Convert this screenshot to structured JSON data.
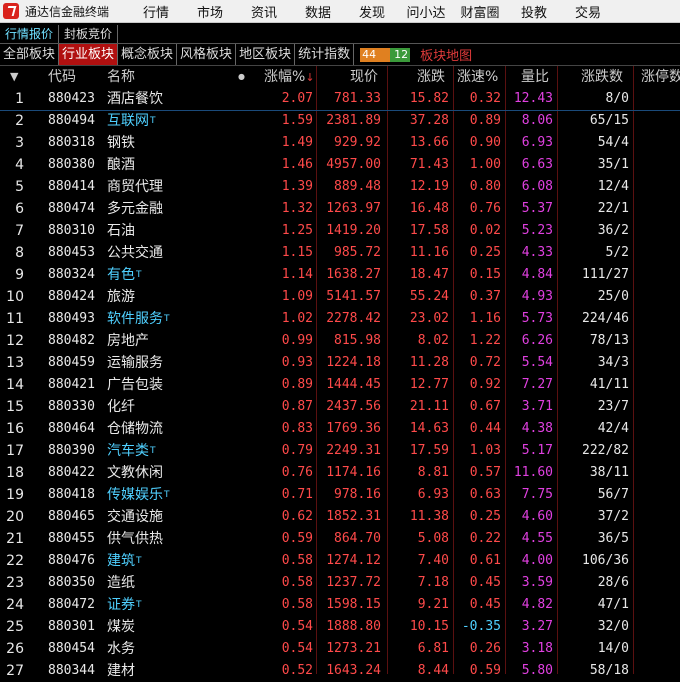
{
  "app": {
    "title": "通达信金融终端",
    "menu": [
      "行情",
      "市场",
      "资讯",
      "数据",
      "发现",
      "问小达",
      "财富圈",
      "投教",
      "交易"
    ]
  },
  "subtabs": [
    "行情报价",
    "封板竞价"
  ],
  "tabs": [
    "全部板块",
    "行业板块",
    "概念板块",
    "风格板块",
    "地区板块",
    "统计指数"
  ],
  "updown": {
    "up": "44",
    "down": "12"
  },
  "map_link": "板块地图",
  "columns": [
    "代码",
    "名称",
    "涨幅%",
    "现价",
    "涨跌",
    "涨速%",
    "量比",
    "涨跌数",
    "涨停数"
  ],
  "sort_arrow": "↓",
  "colors": {
    "up": "#ff4a4a",
    "down": "#4fd0ff",
    "volume_ratio": "#e040e0",
    "tag": "#4fd0ff"
  },
  "rows": [
    {
      "no": "1",
      "code": "880423",
      "name": "酒店餐饮",
      "tag": "",
      "pct": "2.07",
      "price": "781.33",
      "change": "15.82",
      "speed": "0.32",
      "vr": "12.43",
      "counts": "8/0"
    },
    {
      "no": "2",
      "code": "880494",
      "name": "互联网",
      "tag": "T",
      "pct": "1.59",
      "price": "2381.89",
      "change": "37.28",
      "speed": "0.89",
      "vr": "8.06",
      "counts": "65/15"
    },
    {
      "no": "3",
      "code": "880318",
      "name": "钢铁",
      "tag": "",
      "pct": "1.49",
      "price": "929.92",
      "change": "13.66",
      "speed": "0.90",
      "vr": "6.93",
      "counts": "54/4"
    },
    {
      "no": "4",
      "code": "880380",
      "name": "酿酒",
      "tag": "",
      "pct": "1.46",
      "price": "4957.00",
      "change": "71.43",
      "speed": "1.00",
      "vr": "6.63",
      "counts": "35/1"
    },
    {
      "no": "5",
      "code": "880414",
      "name": "商贸代理",
      "tag": "",
      "pct": "1.39",
      "price": "889.48",
      "change": "12.19",
      "speed": "0.80",
      "vr": "6.08",
      "counts": "12/4"
    },
    {
      "no": "6",
      "code": "880474",
      "name": "多元金融",
      "tag": "",
      "pct": "1.32",
      "price": "1263.97",
      "change": "16.48",
      "speed": "0.76",
      "vr": "5.37",
      "counts": "22/1"
    },
    {
      "no": "7",
      "code": "880310",
      "name": "石油",
      "tag": "",
      "pct": "1.25",
      "price": "1419.20",
      "change": "17.58",
      "speed": "0.02",
      "vr": "5.23",
      "counts": "36/2"
    },
    {
      "no": "8",
      "code": "880453",
      "name": "公共交通",
      "tag": "",
      "pct": "1.15",
      "price": "985.72",
      "change": "11.16",
      "speed": "0.25",
      "vr": "4.33",
      "counts": "5/2"
    },
    {
      "no": "9",
      "code": "880324",
      "name": "有色",
      "tag": "T",
      "pct": "1.14",
      "price": "1638.27",
      "change": "18.47",
      "speed": "0.15",
      "vr": "4.84",
      "counts": "111/27"
    },
    {
      "no": "10",
      "code": "880424",
      "name": "旅游",
      "tag": "",
      "pct": "1.09",
      "price": "5141.57",
      "change": "55.24",
      "speed": "0.37",
      "vr": "4.93",
      "counts": "25/0"
    },
    {
      "no": "11",
      "code": "880493",
      "name": "软件服务",
      "tag": "T",
      "pct": "1.02",
      "price": "2278.42",
      "change": "23.02",
      "speed": "1.16",
      "vr": "5.73",
      "counts": "224/46"
    },
    {
      "no": "12",
      "code": "880482",
      "name": "房地产",
      "tag": "",
      "pct": "0.99",
      "price": "815.98",
      "change": "8.02",
      "speed": "1.22",
      "vr": "6.26",
      "counts": "78/13"
    },
    {
      "no": "13",
      "code": "880459",
      "name": "运输服务",
      "tag": "",
      "pct": "0.93",
      "price": "1224.18",
      "change": "11.28",
      "speed": "0.72",
      "vr": "5.54",
      "counts": "34/3"
    },
    {
      "no": "14",
      "code": "880421",
      "name": "广告包装",
      "tag": "",
      "pct": "0.89",
      "price": "1444.45",
      "change": "12.77",
      "speed": "0.92",
      "vr": "7.27",
      "counts": "41/11"
    },
    {
      "no": "15",
      "code": "880330",
      "name": "化纤",
      "tag": "",
      "pct": "0.87",
      "price": "2437.56",
      "change": "21.11",
      "speed": "0.67",
      "vr": "3.71",
      "counts": "23/7"
    },
    {
      "no": "16",
      "code": "880464",
      "name": "仓储物流",
      "tag": "",
      "pct": "0.83",
      "price": "1769.36",
      "change": "14.63",
      "speed": "0.44",
      "vr": "4.38",
      "counts": "42/4"
    },
    {
      "no": "17",
      "code": "880390",
      "name": "汽车类",
      "tag": "T",
      "pct": "0.79",
      "price": "2249.31",
      "change": "17.59",
      "speed": "1.03",
      "vr": "5.17",
      "counts": "222/82"
    },
    {
      "no": "18",
      "code": "880422",
      "name": "文教休闲",
      "tag": "",
      "pct": "0.76",
      "price": "1174.16",
      "change": "8.81",
      "speed": "0.57",
      "vr": "11.60",
      "counts": "38/11"
    },
    {
      "no": "19",
      "code": "880418",
      "name": "传媒娱乐",
      "tag": "T",
      "pct": "0.71",
      "price": "978.16",
      "change": "6.93",
      "speed": "0.63",
      "vr": "7.75",
      "counts": "56/7"
    },
    {
      "no": "20",
      "code": "880465",
      "name": "交通设施",
      "tag": "",
      "pct": "0.62",
      "price": "1852.31",
      "change": "11.38",
      "speed": "0.25",
      "vr": "4.60",
      "counts": "37/2"
    },
    {
      "no": "21",
      "code": "880455",
      "name": "供气供热",
      "tag": "",
      "pct": "0.59",
      "price": "864.70",
      "change": "5.08",
      "speed": "0.22",
      "vr": "4.55",
      "counts": "36/5"
    },
    {
      "no": "22",
      "code": "880476",
      "name": "建筑",
      "tag": "T",
      "pct": "0.58",
      "price": "1274.12",
      "change": "7.40",
      "speed": "0.61",
      "vr": "4.00",
      "counts": "106/36"
    },
    {
      "no": "23",
      "code": "880350",
      "name": "造纸",
      "tag": "",
      "pct": "0.58",
      "price": "1237.72",
      "change": "7.18",
      "speed": "0.45",
      "vr": "3.59",
      "counts": "28/6"
    },
    {
      "no": "24",
      "code": "880472",
      "name": "证券",
      "tag": "T",
      "pct": "0.58",
      "price": "1598.15",
      "change": "9.21",
      "speed": "0.45",
      "vr": "4.82",
      "counts": "47/1"
    },
    {
      "no": "25",
      "code": "880301",
      "name": "煤炭",
      "tag": "",
      "pct": "0.54",
      "price": "1888.80",
      "change": "10.15",
      "speed": "-0.35",
      "vr": "3.27",
      "counts": "32/0"
    },
    {
      "no": "26",
      "code": "880454",
      "name": "水务",
      "tag": "",
      "pct": "0.54",
      "price": "1273.21",
      "change": "6.81",
      "speed": "0.26",
      "vr": "3.18",
      "counts": "14/0"
    },
    {
      "no": "27",
      "code": "880344",
      "name": "建材",
      "tag": "",
      "pct": "0.52",
      "price": "1643.24",
      "change": "8.44",
      "speed": "0.59",
      "vr": "5.80",
      "counts": "58/18"
    }
  ]
}
